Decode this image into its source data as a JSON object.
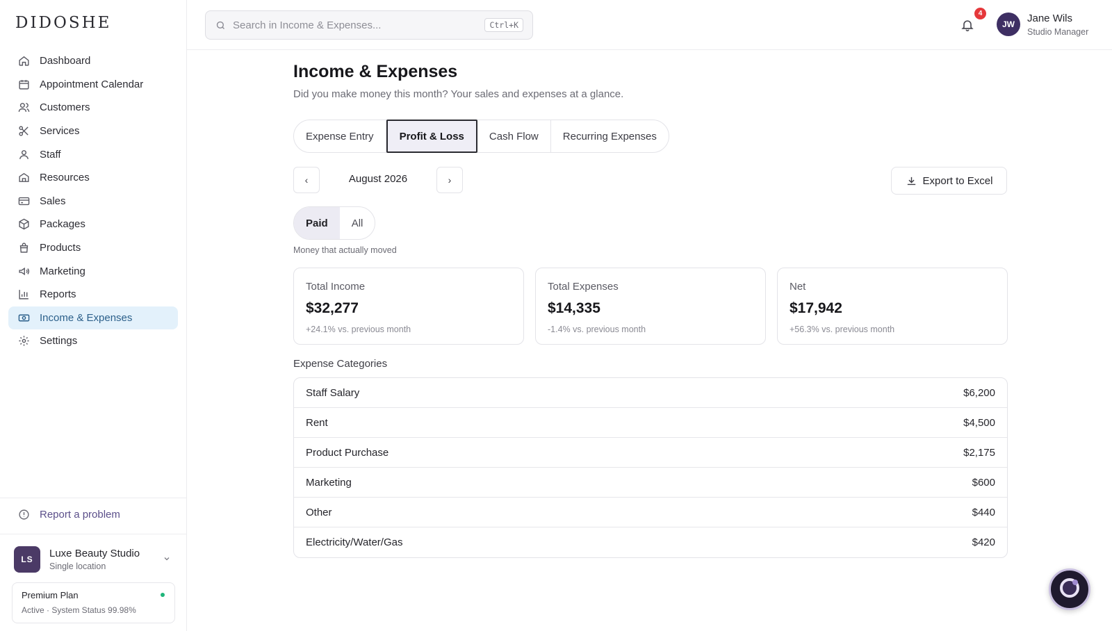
{
  "brand": {
    "logo": "DIDOSHE"
  },
  "sidebar": {
    "items": [
      {
        "label": "Dashboard",
        "icon": "home-icon"
      },
      {
        "label": "Appointment Calendar",
        "icon": "calendar-icon"
      },
      {
        "label": "Customers",
        "icon": "users-icon"
      },
      {
        "label": "Services",
        "icon": "scissors-icon"
      },
      {
        "label": "Staff",
        "icon": "user-icon"
      },
      {
        "label": "Resources",
        "icon": "building-icon"
      },
      {
        "label": "Sales",
        "icon": "credit-card-icon"
      },
      {
        "label": "Packages",
        "icon": "box-icon"
      },
      {
        "label": "Products",
        "icon": "bag-icon"
      },
      {
        "label": "Marketing",
        "icon": "megaphone-icon"
      },
      {
        "label": "Reports",
        "icon": "bar-chart-icon"
      },
      {
        "label": "Income & Expenses",
        "icon": "banknote-icon",
        "active": true
      },
      {
        "label": "Settings",
        "icon": "gear-icon"
      }
    ],
    "report_problem": "Report a problem",
    "studio": {
      "initials": "LS",
      "name": "Luxe Beauty Studio",
      "subtitle": "Single location"
    },
    "plan": {
      "title": "Premium Plan",
      "status": "Active · System Status 99.98%"
    }
  },
  "header": {
    "search": {
      "placeholder": "Search in Income & Expenses...",
      "shortcut": "Ctrl+K"
    },
    "notifications": {
      "count": "4"
    },
    "user": {
      "initials": "JW",
      "name": "Jane Wils",
      "role": "Studio Manager"
    }
  },
  "main": {
    "title": "Income & Expenses",
    "subtitle": "Did you make money this month? Your sales and expenses at a glance.",
    "tabs": [
      {
        "label": "Expense Entry"
      },
      {
        "label": "Profit & Loss",
        "active": true
      },
      {
        "label": "Cash Flow"
      },
      {
        "label": "Recurring Expenses"
      }
    ],
    "period": {
      "prev": "‹",
      "label": "August 2026",
      "next": "›"
    },
    "export_label": "Export to Excel",
    "filter": {
      "options": [
        "Paid",
        "All"
      ],
      "selected": "Paid",
      "hint": "Money that actually moved"
    },
    "cards": [
      {
        "label": "Total Income",
        "value": "$32,277",
        "delta": "+24.1% vs. previous month"
      },
      {
        "label": "Total Expenses",
        "value": "$14,335",
        "delta": "-1.4% vs. previous month"
      },
      {
        "label": "Net",
        "value": "$17,942",
        "delta": "+56.3% vs. previous month"
      }
    ],
    "expense_categories": {
      "title": "Expense Categories",
      "rows": [
        {
          "name": "Staff Salary",
          "amount": "$6,200"
        },
        {
          "name": "Rent",
          "amount": "$4,500"
        },
        {
          "name": "Product Purchase",
          "amount": "$2,175"
        },
        {
          "name": "Marketing",
          "amount": "$600"
        },
        {
          "name": "Other",
          "amount": "$440"
        },
        {
          "name": "Electricity/Water/Gas",
          "amount": "$420"
        }
      ]
    }
  },
  "colors": {
    "accent": "#2b5f8a",
    "active_bg": "#e3f1fb",
    "badge": "#e5383b",
    "avatar": "#3e2f63"
  }
}
